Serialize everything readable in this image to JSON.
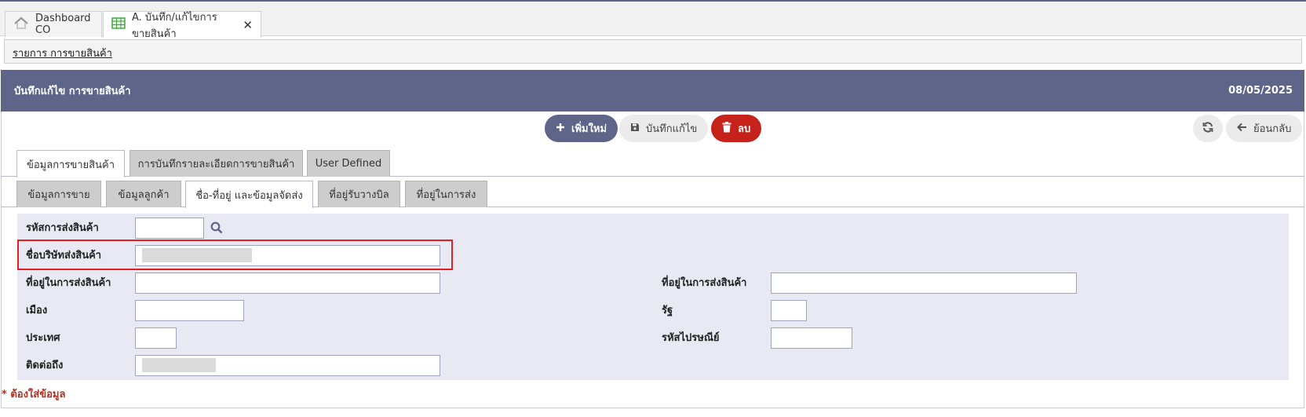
{
  "tabs": [
    {
      "label": "Dashboard CO",
      "icon": "home-icon"
    },
    {
      "label": "A. บันทึก/แก้ไขการขายสินค้า",
      "icon": "spreadsheet-icon",
      "close": "✕"
    }
  ],
  "breadcrumb": {
    "label": "รายการ การขายสินค้า"
  },
  "header": {
    "title": "บันทึกแก้ไข การขายสินค้า",
    "date": "08/05/2025"
  },
  "toolbar": {
    "add_label": "เพิ่มใหม่",
    "save_label": "บันทึกแก้ไข",
    "delete_label": "ลบ",
    "back_label": "ย้อนกลับ"
  },
  "main_tabs": [
    {
      "label": "ข้อมูลการขายสินค้า",
      "active": true
    },
    {
      "label": "การบันทึกรายละเอียดการขายสินค้า",
      "active": false
    },
    {
      "label": "User Defined",
      "active": false
    }
  ],
  "sub_tabs": [
    {
      "label": "ข้อมูลการขาย",
      "active": false
    },
    {
      "label": "ข้อมูลลูกค้า",
      "active": false
    },
    {
      "label": "ชื่อ-ที่อยู่ และข้อมูลจัดส่ง",
      "active": true
    },
    {
      "label": "ที่อยู่รับวางบิล",
      "active": false
    },
    {
      "label": "ที่อยู่ในการส่ง",
      "active": false
    }
  ],
  "form": {
    "shipping_code": {
      "label": "รหัสการส่งสินค้า",
      "value": ""
    },
    "shipping_company": {
      "label": "ชื่อบริษัทส่งสินค้า",
      "value": ""
    },
    "address1": {
      "label": "ที่อยู่ในการส่งสินค้า",
      "value": ""
    },
    "address2": {
      "label": "ที่อยู่ในการส่งสินค้า",
      "value": ""
    },
    "city": {
      "label": "เมือง",
      "value": ""
    },
    "state": {
      "label": "รัฐ",
      "value": ""
    },
    "country": {
      "label": "ประเทศ",
      "value": ""
    },
    "postal": {
      "label": "รหัสไปรษณีย์",
      "value": ""
    },
    "contact": {
      "label": "ติดต่อถึง",
      "value": ""
    }
  },
  "required_note": "* ต้องใส่ข้อมูล",
  "colors": {
    "header": "#5f6589",
    "danger": "#c4221b",
    "form_bg": "#e9e9f3",
    "required": "#b92e1e"
  }
}
